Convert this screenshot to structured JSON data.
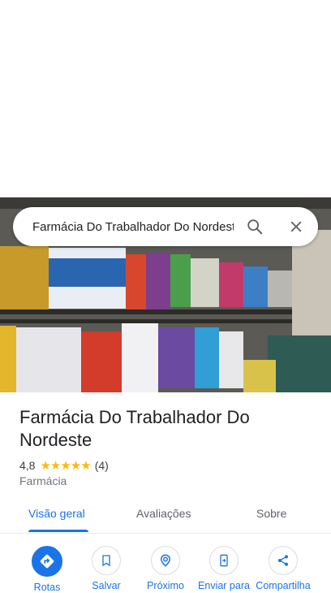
{
  "search": {
    "query": "Farmácia Do Trabalhador Do Nordeste"
  },
  "place": {
    "name": "Farmácia Do Trabalhador Do Nordeste",
    "rating": "4,8",
    "stars": "★★★★★",
    "review_count": "(4)",
    "category": "Farmácia"
  },
  "tabs": [
    {
      "label": "Visão geral"
    },
    {
      "label": "Avaliações"
    },
    {
      "label": "Sobre"
    }
  ],
  "actions": [
    {
      "label": "Rotas",
      "icon": "directions-icon"
    },
    {
      "label": "Salvar",
      "icon": "bookmark-icon"
    },
    {
      "label": "Próximo",
      "icon": "nearby-icon"
    },
    {
      "label": "Enviar para",
      "icon": "send-to-phone-icon"
    },
    {
      "label": "Compartilha",
      "icon": "share-icon"
    }
  ],
  "colors": {
    "accent": "#1a73e8",
    "star": "#fbbc04",
    "text": "#202124",
    "muted": "#70757a"
  }
}
